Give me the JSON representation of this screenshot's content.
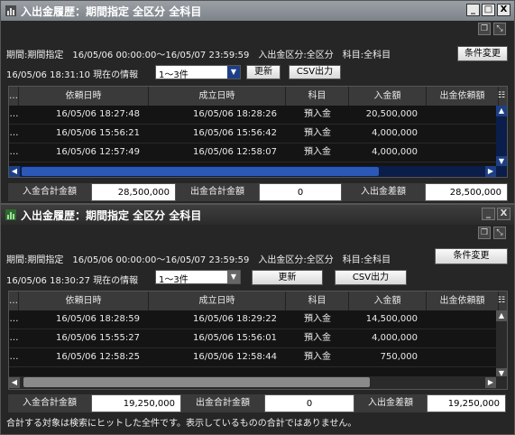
{
  "colors": {
    "title_bar_top": "#8a9096",
    "title_bar_bottom": "#2e2e2e",
    "grid_bg": "#141414",
    "scroll_blue": "#1d3f86"
  },
  "windows": [
    {
      "title": "入出金履歴：期間指定 全区分 全科目",
      "controls": [
        "_",
        "□",
        "X"
      ],
      "condition": "期間:期間指定　16/05/06 00:00:00～16/05/07 23:59:59　入出金区分:全区分　科目:全科目",
      "change_button": "条件変更",
      "info_time": "16/05/06 18:31:10 現在の情報",
      "range_value": "1～3件",
      "refresh_button": "更新",
      "csv_button": "CSV出力",
      "columns": [
        "…",
        "依頼日時",
        "成立日時",
        "科目",
        "入金額",
        "出金依頼額"
      ],
      "rows": [
        {
          "marker": "…",
          "request": "16/05/06 18:27:48",
          "executed": "16/05/06 18:28:26",
          "subject": "預入金",
          "deposit": "20,500,000",
          "withdraw": ""
        },
        {
          "marker": "…",
          "request": "16/05/06 15:56:21",
          "executed": "16/05/06 15:56:42",
          "subject": "預入金",
          "deposit": "4,000,000",
          "withdraw": ""
        },
        {
          "marker": "…",
          "request": "16/05/06 12:57:49",
          "executed": "16/05/06 12:58:07",
          "subject": "預入金",
          "deposit": "4,000,000",
          "withdraw": ""
        }
      ],
      "totals": {
        "deposit_label": "入金合計金額",
        "deposit_value": "28,500,000",
        "withdraw_label": "出金合計金額",
        "withdraw_value": "0",
        "diff_label": "入出金差額",
        "diff_value": "28,500,000"
      }
    },
    {
      "title": "入出金履歴：期間指定 全区分 全科目",
      "controls": [
        "_",
        "X"
      ],
      "condition": "期間:期間指定　16/05/06 00:00:00～16/05/07 23:59:59　入出金区分:全区分　科目:全科目",
      "change_button": "条件変更",
      "info_time": "16/05/06 18:30:27 現在の情報",
      "range_value": "1～3件",
      "refresh_button": "更新",
      "csv_button": "CSV出力",
      "columns": [
        "…",
        "依頼日時",
        "成立日時",
        "科目",
        "入金額",
        "出金依頼額"
      ],
      "rows": [
        {
          "marker": "…",
          "request": "16/05/06 18:28:59",
          "executed": "16/05/06 18:29:22",
          "subject": "預入金",
          "deposit": "14,500,000",
          "withdraw": ""
        },
        {
          "marker": "…",
          "request": "16/05/06 15:55:27",
          "executed": "16/05/06 15:56:01",
          "subject": "預入金",
          "deposit": "4,000,000",
          "withdraw": ""
        },
        {
          "marker": "…",
          "request": "16/05/06 12:58:25",
          "executed": "16/05/06 12:58:44",
          "subject": "預入金",
          "deposit": "750,000",
          "withdraw": ""
        }
      ],
      "totals": {
        "deposit_label": "入金合計金額",
        "deposit_value": "19,250,000",
        "withdraw_label": "出金合計金額",
        "withdraw_value": "0",
        "diff_label": "入出金差額",
        "diff_value": "19,250,000"
      },
      "note": "合計する対象は検索にヒットした全件です。表示しているものの合計ではありません。"
    }
  ]
}
